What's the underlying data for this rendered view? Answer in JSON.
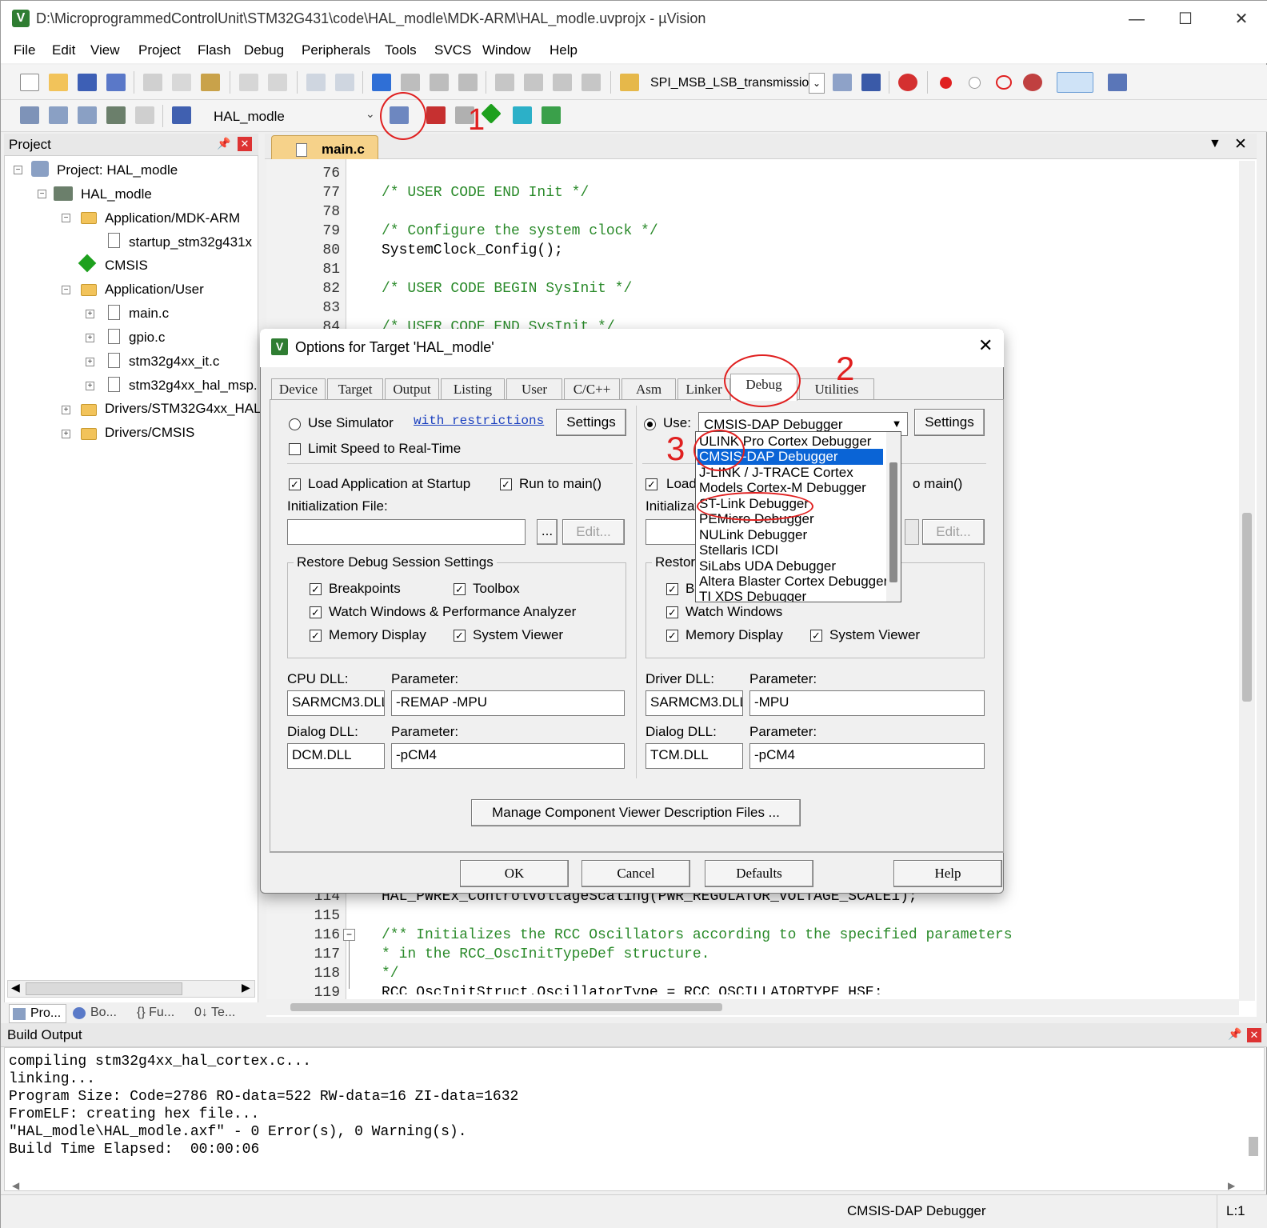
{
  "window": {
    "title": "D:\\MicroprogrammedControlUnit\\STM32G431\\code\\HAL_modle\\MDK-ARM\\HAL_modle.uvprojx - µVision",
    "controls": [
      "—",
      "☐",
      "✕"
    ]
  },
  "menu": [
    "File",
    "Edit",
    "View",
    "Project",
    "Flash",
    "Debug",
    "Peripherals",
    "Tools",
    "SVCS",
    "Window",
    "Help"
  ],
  "toolbar1": {
    "combo_value": "SPI_MSB_LSB_transmission"
  },
  "toolbar2": {
    "target_value": "HAL_modle"
  },
  "project_panel": {
    "title": "Project",
    "tree": [
      {
        "label": "Project: HAL_modle",
        "level": 0,
        "icon": "project-icon"
      },
      {
        "label": "HAL_modle",
        "level": 1,
        "icon": "target-icon"
      },
      {
        "label": "Application/MDK-ARM",
        "level": 2,
        "icon": "folder-icon"
      },
      {
        "label": "startup_stm32g431x",
        "level": 3,
        "icon": "file-icon"
      },
      {
        "label": "CMSIS",
        "level": 2,
        "icon": "cmsis-icon"
      },
      {
        "label": "Application/User",
        "level": 2,
        "icon": "folder-icon"
      },
      {
        "label": "main.c",
        "level": 3,
        "icon": "file-icon"
      },
      {
        "label": "gpio.c",
        "level": 3,
        "icon": "file-icon"
      },
      {
        "label": "stm32g4xx_it.c",
        "level": 3,
        "icon": "file-icon"
      },
      {
        "label": "stm32g4xx_hal_msp.",
        "level": 3,
        "icon": "file-icon"
      },
      {
        "label": "Drivers/STM32G4xx_HAL",
        "level": 2,
        "icon": "folder-icon"
      },
      {
        "label": "Drivers/CMSIS",
        "level": 2,
        "icon": "folder-icon"
      }
    ],
    "bottom_tabs": [
      "Pro...",
      "Bo...",
      "{} Fu...",
      "0↓ Te..."
    ]
  },
  "editor": {
    "tab": "main.c",
    "lines_top": [
      {
        "n": "76",
        "code": ""
      },
      {
        "n": "77",
        "code": "/* USER CODE END Init */",
        "cmt": true
      },
      {
        "n": "78",
        "code": ""
      },
      {
        "n": "79",
        "code": "/* Configure the system clock */",
        "cmt": true
      },
      {
        "n": "80",
        "code": "SystemClock_Config();"
      },
      {
        "n": "81",
        "code": ""
      },
      {
        "n": "82",
        "code": "/* USER CODE BEGIN SysInit */",
        "cmt": true
      },
      {
        "n": "83",
        "code": ""
      },
      {
        "n": "84",
        "code": "/* USER CODE END SysInit */",
        "cmt": true
      }
    ],
    "lines_bottom": [
      {
        "n": "114",
        "code": "HAL_PWREx_ControlVoltageScaling(PWR_REGULATOR_VOLTAGE_SCALE1);"
      },
      {
        "n": "115",
        "code": ""
      },
      {
        "n": "116",
        "code": "/** Initializes the RCC Oscillators according to the specified parameters",
        "cmt": true
      },
      {
        "n": "117",
        "code": "* in the RCC_OscInitTypeDef structure.",
        "cmt": true
      },
      {
        "n": "118",
        "code": "*/",
        "cmt": true
      },
      {
        "n": "119",
        "code": "RCC_OscInitStruct.OscillatorType = RCC_OSCILLATORTYPE_HSE;"
      }
    ]
  },
  "dialog": {
    "title": "Options for Target 'HAL_modle'",
    "tabs": [
      "Device",
      "Target",
      "Output",
      "Listing",
      "User",
      "C/C++",
      "Asm",
      "Linker",
      "Debug",
      "Utilities"
    ],
    "active_tab": "Debug",
    "left": {
      "use_simulator": "Use Simulator",
      "restrictions_link": "with restrictions",
      "settings": "Settings",
      "limit_speed": "Limit Speed to Real-Time",
      "load_app": "Load Application at Startup",
      "run_to_main": "Run to main()",
      "init_file_label": "Initialization File:",
      "browse": "...",
      "edit": "Edit...",
      "restore_group": "Restore Debug Session Settings",
      "breakpoints": "Breakpoints",
      "toolbox": "Toolbox",
      "watch_windows": "Watch Windows & Performance Analyzer",
      "memory_display": "Memory Display",
      "system_viewer": "System Viewer",
      "cpu_dll_label": "CPU DLL:",
      "cpu_dll": "SARMCM3.DLL",
      "param_label": "Parameter:",
      "cpu_param": "-REMAP -MPU",
      "dialog_dll_label": "Dialog DLL:",
      "dialog_dll": "DCM.DLL",
      "dialog_param": "-pCM4"
    },
    "right": {
      "use": "Use:",
      "debugger_selected": "CMSIS-DAP Debugger",
      "settings": "Settings",
      "load": "Load",
      "run_main": "o main()",
      "init_label": "Initializati",
      "edit": "Edit...",
      "restore": "Restore",
      "bre": "Bre",
      "watch": "Watch Windows",
      "memory_display": "Memory Display",
      "system_viewer": "System Viewer",
      "driver_dll_label": "Driver DLL:",
      "driver_dll": "SARMCM3.DLL",
      "param_label": "Parameter:",
      "driver_param": "-MPU",
      "dialog_dll_label": "Dialog DLL:",
      "dialog_dll": "TCM.DLL",
      "dialog_param": "-pCM4"
    },
    "debugger_options": [
      "ULINK Pro Cortex Debugger",
      "CMSIS-DAP Debugger",
      "J-LINK / J-TRACE Cortex",
      "Models Cortex-M Debugger",
      "ST-Link Debugger",
      "PEMicro Debugger",
      "NULink Debugger",
      "Stellaris ICDI",
      "SiLabs UDA Debugger",
      "Altera Blaster Cortex Debugger",
      "TI XDS Debugger"
    ],
    "manage_btn": "Manage Component Viewer Description Files ...",
    "ok": "OK",
    "cancel": "Cancel",
    "defaults": "Defaults",
    "help": "Help"
  },
  "annotations": [
    "1",
    "2",
    "3"
  ],
  "build_output": {
    "title": "Build Output",
    "lines": [
      "compiling stm32g4xx_hal_cortex.c...",
      "linking...",
      "Program Size: Code=2786 RO-data=522 RW-data=16 ZI-data=1632",
      "FromELF: creating hex file...",
      "\"HAL_modle\\HAL_modle.axf\" - 0 Error(s), 0 Warning(s).",
      "Build Time Elapsed:  00:00:06"
    ]
  },
  "status": {
    "debugger": "CMSIS-DAP Debugger",
    "line": "L:1"
  },
  "colors": {
    "accent": "#0a64d6",
    "annotation": "#e02020",
    "comment": "#2a8a2a"
  }
}
